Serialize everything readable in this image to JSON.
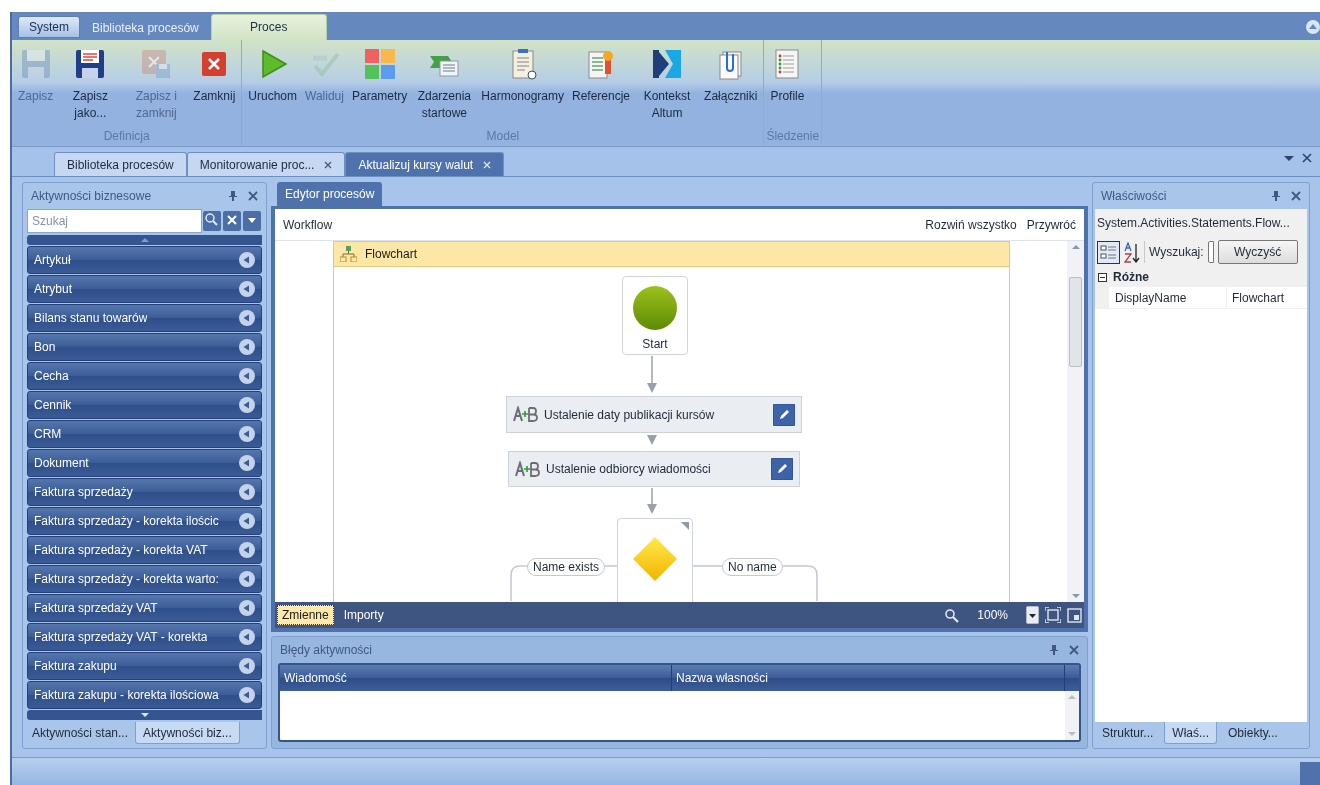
{
  "ribbon": {
    "tabs": [
      {
        "label": "System",
        "selected": false,
        "kind": "menu"
      },
      {
        "label": "Biblioteka procesów",
        "selected": false,
        "kind": "tab"
      },
      {
        "label": "Proces",
        "selected": true,
        "kind": "tab"
      }
    ],
    "groups": [
      {
        "label": "Definicja",
        "buttons": [
          {
            "label": "Zapisz",
            "kind": "save",
            "disabled": true
          },
          {
            "label": "Zapisz jako...",
            "kind": "save-as",
            "disabled": false
          },
          {
            "label": "Zapisz i zamknij",
            "kind": "save-close",
            "disabled": true
          },
          {
            "label": "Zamknij",
            "kind": "close",
            "disabled": false
          }
        ]
      },
      {
        "label": "Model",
        "buttons": [
          {
            "label": "Uruchom",
            "kind": "run",
            "disabled": false
          },
          {
            "label": "Waliduj",
            "kind": "validate",
            "disabled": true
          },
          {
            "label": "Parametry",
            "kind": "params",
            "disabled": false
          },
          {
            "label": "Zdarzenia startowe",
            "kind": "events",
            "disabled": false
          },
          {
            "label": "Harmonogramy",
            "kind": "schedule",
            "disabled": false
          },
          {
            "label": "Referencje",
            "kind": "reference",
            "disabled": false
          },
          {
            "label": "Kontekst Altum",
            "kind": "context",
            "disabled": false
          },
          {
            "label": "Załączniki",
            "kind": "attachment",
            "disabled": false
          }
        ]
      },
      {
        "label": "Śledzenie",
        "buttons": [
          {
            "label": "Profile",
            "kind": "profile",
            "disabled": false
          }
        ]
      }
    ]
  },
  "document_tabs": [
    {
      "label": "Biblioteka procesów",
      "selected": false,
      "closable": false
    },
    {
      "label": "Monitorowanie proc...",
      "selected": false,
      "closable": true
    },
    {
      "label": "Aktualizuj kursy walut",
      "selected": true,
      "closable": true
    }
  ],
  "activities_panel": {
    "title": "Aktywności biznesowe",
    "search": {
      "placeholder": "Szukaj"
    },
    "items": [
      "Artykuł",
      "Atrybut",
      "Bilans stanu towarów",
      "Bon",
      "Cecha",
      "Cennik",
      "CRM",
      "Dokument",
      "Faktura sprzedaży",
      "Faktura sprzedaży - korekta ilościc",
      "Faktura sprzedaży - korekta VAT",
      "Faktura sprzedaży - korekta warto:",
      "Faktura sprzedaży VAT",
      "Faktura sprzedaży VAT - korekta",
      "Faktura zakupu",
      "Faktura zakupu - korekta ilościowa"
    ],
    "tabs": [
      {
        "label": "Aktywności stan...",
        "selected": false
      },
      {
        "label": "Aktywności biz...",
        "selected": true
      }
    ]
  },
  "editor": {
    "tab": "Edytor procesów",
    "breadcrumb": "Workflow",
    "actions": [
      "Rozwiń wszystko",
      "Przywróć"
    ],
    "flowchart": {
      "title": "Flowchart",
      "nodes": [
        {
          "kind": "start",
          "label": "Start"
        },
        {
          "kind": "assign",
          "label": "Ustalenie daty publikacji kursów"
        },
        {
          "kind": "assign",
          "label": "Ustalenie odbiorcy wiadomości"
        },
        {
          "kind": "decision"
        }
      ],
      "branches": [
        "Name exists",
        "No name"
      ]
    },
    "bottom_tabs": [
      {
        "label": "Zmienne",
        "selected": true
      },
      {
        "label": "Importy",
        "selected": false
      }
    ],
    "zoom": "100%"
  },
  "errors_panel": {
    "title": "Błędy aktywności",
    "columns": [
      "Wiadomość",
      "Nazwa własności"
    ]
  },
  "properties_panel": {
    "title": "Właściwości",
    "object": "System.Activities.Statements.Flow...",
    "search_label": "Wyszukaj:",
    "clear_button": "Wyczyść",
    "categories": [
      {
        "label": "Różne",
        "expanded": true,
        "properties": [
          {
            "name": "DisplayName",
            "value": "Flowchart"
          }
        ]
      }
    ],
    "tabs": [
      {
        "label": "Struktur...",
        "selected": false
      },
      {
        "label": "Właś...",
        "selected": true
      },
      {
        "label": "Obiekty...",
        "selected": false
      }
    ]
  }
}
